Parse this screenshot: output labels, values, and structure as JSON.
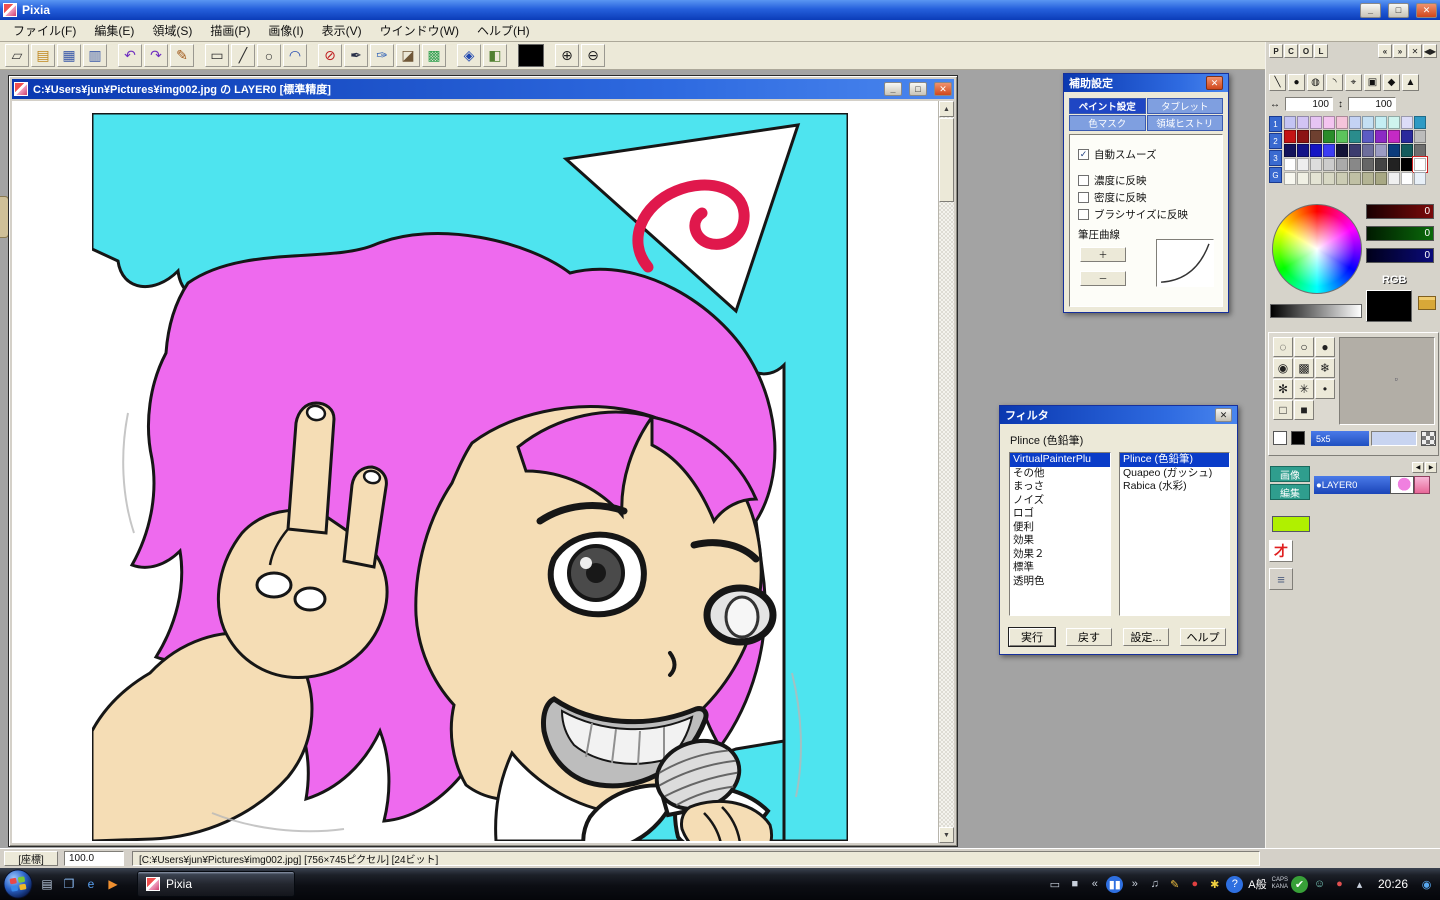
{
  "app_window": {
    "title": "Pixia",
    "minimize_glyph": "_",
    "maximize_glyph": "□",
    "close_glyph": "✕"
  },
  "menu": {
    "items": [
      "ファイル(F)",
      "編集(E)",
      "領域(S)",
      "描画(P)",
      "画像(I)",
      "表示(V)",
      "ウインドウ(W)",
      "ヘルプ(H)"
    ]
  },
  "toolbar": {
    "items": [
      {
        "name": "new-file-icon",
        "glyph": "▱",
        "color": "#404040"
      },
      {
        "name": "open-file-icon",
        "glyph": "▤",
        "color": "#c08820"
      },
      {
        "name": "save-file-icon",
        "glyph": "▦",
        "color": "#3858a8"
      },
      {
        "name": "scanner-icon",
        "glyph": "▥",
        "color": "#3858a8"
      },
      {
        "gap": true
      },
      {
        "name": "undo-icon",
        "glyph": "↶",
        "color": "#7030c0"
      },
      {
        "name": "redo-icon",
        "glyph": "↷",
        "color": "#7030c0"
      },
      {
        "name": "text-tool-icon",
        "glyph": "✎",
        "color": "#a05818"
      },
      {
        "gap": true
      },
      {
        "name": "select-rect-icon",
        "glyph": "▭",
        "color": "#303030"
      },
      {
        "name": "line-tool-icon",
        "glyph": "╱",
        "color": "#303030"
      },
      {
        "name": "ellipse-tool-icon",
        "glyph": "○",
        "color": "#303030"
      },
      {
        "name": "bezier-tool-icon",
        "glyph": "◠",
        "color": "#2048b0"
      },
      {
        "gap": true
      },
      {
        "name": "mask-icon",
        "glyph": "⊘",
        "color": "#c02020"
      },
      {
        "name": "pen-tool-icon",
        "glyph": "✒",
        "color": "#283048"
      },
      {
        "name": "nib-tool-icon",
        "glyph": "✑",
        "color": "#3868b8"
      },
      {
        "name": "eraser-tool-icon",
        "glyph": "◪",
        "color": "#705838"
      },
      {
        "name": "tile-tool-icon",
        "glyph": "▩",
        "color": "#30a050"
      },
      {
        "gap": true
      },
      {
        "name": "fill-tool-icon",
        "glyph": "◈",
        "color": "#2048b0"
      },
      {
        "name": "gradient-tool-icon",
        "glyph": "◧",
        "color": "#508030"
      },
      {
        "gap": true
      },
      {
        "name": "current-color-swatch",
        "swatch": "#000000"
      },
      {
        "gap": true
      },
      {
        "name": "zoom-in-icon",
        "glyph": "⊕",
        "color": "#202020"
      },
      {
        "name": "zoom-out-icon",
        "glyph": "⊖",
        "color": "#202020"
      }
    ]
  },
  "canvas_window": {
    "title": "C:¥Users¥jun¥Pictures¥img002.jpg の LAYER0 [標準精度]",
    "minimize_glyph": "_",
    "maximize_glyph": "□",
    "close_glyph": "✕",
    "scroll_up_glyph": "▲",
    "scroll_down_glyph": "▼"
  },
  "aux_dialog": {
    "title": "補助設定",
    "close_glyph": "✕",
    "tabs": [
      {
        "label": "ペイント設定",
        "active": true
      },
      {
        "label": "タブレット",
        "active": false
      },
      {
        "label": "色マスク",
        "active": false
      },
      {
        "label": "領域ヒストリ",
        "active": false
      }
    ],
    "checkboxes": [
      {
        "label": "自動スムーズ",
        "checked": true
      },
      {
        "label": "濃度に反映",
        "checked": false
      },
      {
        "label": "密度に反映",
        "checked": false
      },
      {
        "label": "ブラシサイズに反映",
        "checked": false
      }
    ],
    "pressure_curve_label": "筆圧曲線",
    "plus_label": "＋",
    "minus_label": "－"
  },
  "filter_dialog": {
    "title": "フィルタ",
    "close_glyph": "✕",
    "current_filter": "Plince (色鉛筆)",
    "categories": [
      {
        "label": "VirtualPainterPlu",
        "selected": true
      },
      {
        "label": "その他"
      },
      {
        "label": "まっさ"
      },
      {
        "label": "ノイズ"
      },
      {
        "label": "ロゴ"
      },
      {
        "label": "便利"
      },
      {
        "label": "効果"
      },
      {
        "label": "効果２"
      },
      {
        "label": "標準"
      },
      {
        "label": "透明色"
      }
    ],
    "filters": [
      {
        "label": "Plince (色鉛筆)",
        "selected": true
      },
      {
        "label": "Quapeo (ガッシュ)"
      },
      {
        "label": "Rabica (水彩)"
      }
    ],
    "buttons": [
      "実行",
      "戻す",
      "設定...",
      "ヘルプ"
    ]
  },
  "right_panel": {
    "mode_buttons": [
      "P",
      "C",
      "O",
      "L"
    ],
    "dock_icons": [
      {
        "name": "dock-prev-icon",
        "glyph": "«"
      },
      {
        "name": "dock-next-icon",
        "glyph": "»"
      },
      {
        "name": "panel-close-icon",
        "glyph": "✕"
      },
      {
        "name": "panel-expand-icon",
        "glyph": "◀▶"
      }
    ],
    "tool_icons": [
      {
        "name": "pen-slash-icon",
        "glyph": "╲"
      },
      {
        "name": "round-pen-icon",
        "glyph": "●"
      },
      {
        "name": "soft-pen-icon",
        "glyph": "◍"
      },
      {
        "name": "arc-pen-icon",
        "glyph": "◝"
      },
      {
        "name": "picker-icon",
        "glyph": "⌖"
      },
      {
        "name": "pattern-pen-icon",
        "glyph": "▣"
      },
      {
        "name": "diamond-pen-icon",
        "glyph": "◆"
      },
      {
        "name": "misc-pen-icon",
        "glyph": "▲"
      }
    ],
    "pen_width_value": "100",
    "pen_density_value": "100",
    "palette_tabs": [
      "1",
      "2",
      "3",
      "G"
    ],
    "palette_selected": [
      3,
      10
    ],
    "palette_rows": [
      [
        "#c4c4f4",
        "#d2c4f4",
        "#e6c4f4",
        "#f4c4f0",
        "#f4c4da",
        "#c4d2f4",
        "#c4e0f4",
        "#c4eef4",
        "#cef4ee",
        "#dcdcf8",
        "#2e9ac4"
      ],
      [
        "#c41414",
        "#8c1414",
        "#6e4030",
        "#2a8c2a",
        "#5cc45c",
        "#2a8c8c",
        "#5c5cc4",
        "#8c2ac4",
        "#c42ac4",
        "#2a2a9c",
        "#bcbcbc"
      ],
      [
        "#14145c",
        "#141488",
        "#1414c4",
        "#3c3cf4",
        "#141438",
        "#3c3c6e",
        "#6e6e9c",
        "#9c9cc4",
        "#0c3c7c",
        "#145c5c",
        "#6e6e6e"
      ],
      [
        "#ffffff",
        "#eeeeee",
        "#dddddd",
        "#cccccc",
        "#aaaaaa",
        "#888888",
        "#666666",
        "#444444",
        "#222222",
        "#000000",
        "#ffffff"
      ],
      [
        "#f8f8f0",
        "#f0f0e4",
        "#e4e4d4",
        "#d8d8c4",
        "#ccccb4",
        "#c0c0a4",
        "#b4b494",
        "#a8a884",
        "#f0f0f0",
        "#ffffff",
        "#e8f0f8"
      ]
    ],
    "rgb": {
      "r_value": "0",
      "g_value": "0",
      "b_value": "0",
      "label": "RGB"
    },
    "brush_shapes": [
      {
        "name": "dotted-circle-brush",
        "glyph": "◌"
      },
      {
        "name": "outline-circle-brush",
        "glyph": "○"
      },
      {
        "name": "solid-circle-brush",
        "glyph": "●"
      },
      {
        "name": "soft-circle-brush",
        "glyph": "◉"
      },
      {
        "name": "halftone-circle-brush",
        "glyph": "▩"
      },
      {
        "name": "snowflake-brush",
        "glyph": "❄"
      },
      {
        "name": "sparkle-brush",
        "glyph": "✻"
      },
      {
        "name": "star-brush",
        "glyph": "✳"
      },
      {
        "name": "dot-brush",
        "glyph": "•"
      },
      {
        "name": "square-brush",
        "glyph": "□"
      },
      {
        "name": "solid-square-brush",
        "glyph": "■"
      }
    ],
    "grid_size_label": "5x5",
    "layer_tabs": [
      "画像",
      "編集"
    ],
    "layer_name": "●LAYER0"
  },
  "status_bar": {
    "coord_button": "[座標]",
    "zoom": "100.0",
    "info": "[C:¥Users¥jun¥Pictures¥img002.jpg] [756×745ピクセル] [24ビット]"
  },
  "taskbar": {
    "quick_launch": [
      {
        "name": "show-desktop-icon",
        "glyph": "▤",
        "color": "#b8c8dc"
      },
      {
        "name": "switch-windows-icon",
        "glyph": "❐",
        "color": "#88b8f0"
      },
      {
        "name": "browser-icon",
        "glyph": "e",
        "color": "#58a0f0"
      },
      {
        "name": "media-player-icon",
        "glyph": "▶",
        "color": "#f09030"
      }
    ],
    "app_button": "Pixia",
    "tray": [
      {
        "type": "icon",
        "name": "tablet-icon",
        "glyph": "▭",
        "color": "#c8d0dc"
      },
      {
        "type": "icon",
        "name": "stop-icon",
        "glyph": "■",
        "color": "#c8d0dc"
      },
      {
        "type": "icon",
        "name": "previous-track-icon",
        "glyph": "«",
        "color": "#c8d0dc"
      },
      {
        "type": "icon",
        "name": "pause-icon",
        "glyph": "▮▮",
        "color": "#ffffff",
        "bg": "#2e6fe0",
        "round": true
      },
      {
        "type": "icon",
        "name": "next-track-icon",
        "glyph": "»",
        "color": "#c8d0dc"
      },
      {
        "type": "icon",
        "name": "volume-icon",
        "glyph": "♫",
        "color": "#c8d0dc"
      },
      {
        "type": "icon",
        "name": "pen-settings-icon",
        "glyph": "✎",
        "color": "#f0c040"
      },
      {
        "type": "icon",
        "name": "update-icon",
        "glyph": "●",
        "color": "#e04040"
      },
      {
        "type": "icon",
        "name": "ime-pad-icon",
        "glyph": "✱",
        "color": "#f0d040"
      },
      {
        "type": "icon",
        "name": "help-icon",
        "glyph": "?",
        "color": "#ffffff",
        "bg": "#2e6fe0",
        "round": true
      },
      {
        "type": "text",
        "name": "ime-mode-indicator",
        "text": "A般"
      },
      {
        "type": "stack",
        "name": "key-state-indicator",
        "lines": [
          "CAPS",
          "KANA"
        ]
      },
      {
        "type": "icon",
        "name": "security-icon",
        "glyph": "✔",
        "color": "#ffffff",
        "bg": "#38a038",
        "round": true
      },
      {
        "type": "icon",
        "name": "messenger-icon",
        "glyph": "☺",
        "color": "#7fd4c4"
      },
      {
        "type": "icon",
        "name": "alert-icon",
        "glyph": "●",
        "color": "#e05050"
      },
      {
        "type": "icon",
        "name": "network-icon",
        "glyph": "▴",
        "color": "#c8d0dc"
      }
    ],
    "clock": "20:26",
    "sidebar_glyph": "◉"
  },
  "artwork": {
    "colors": {
      "cyan": "#4ee4ef",
      "hair": "#ee6aee",
      "skin": "#f5ddb5",
      "red": "#e0184c",
      "line": "#161616",
      "eye": "#4a4a4a"
    }
  }
}
